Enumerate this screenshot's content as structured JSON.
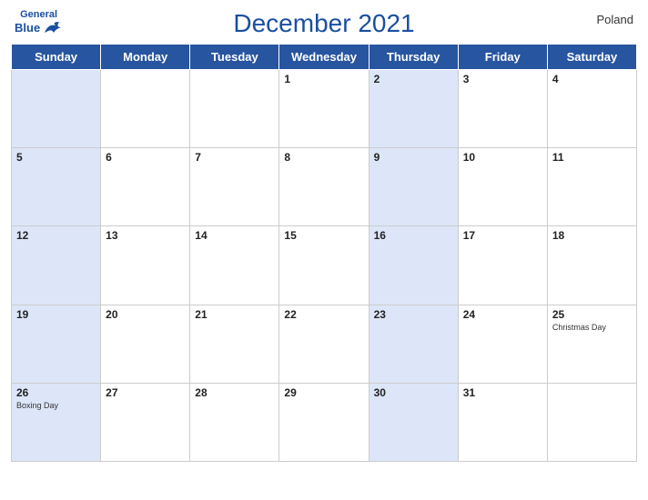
{
  "header": {
    "title": "December 2021",
    "country": "Poland",
    "logo": {
      "general": "General",
      "blue": "Blue"
    }
  },
  "days_of_week": [
    "Sunday",
    "Monday",
    "Tuesday",
    "Wednesday",
    "Thursday",
    "Friday",
    "Saturday"
  ],
  "weeks": [
    [
      {
        "num": "",
        "shaded": true,
        "holiday": ""
      },
      {
        "num": "",
        "shaded": false,
        "holiday": ""
      },
      {
        "num": "",
        "shaded": false,
        "holiday": ""
      },
      {
        "num": "1",
        "shaded": false,
        "holiday": ""
      },
      {
        "num": "2",
        "shaded": true,
        "holiday": ""
      },
      {
        "num": "3",
        "shaded": false,
        "holiday": ""
      },
      {
        "num": "4",
        "shaded": false,
        "holiday": ""
      }
    ],
    [
      {
        "num": "5",
        "shaded": true,
        "holiday": ""
      },
      {
        "num": "6",
        "shaded": false,
        "holiday": ""
      },
      {
        "num": "7",
        "shaded": false,
        "holiday": ""
      },
      {
        "num": "8",
        "shaded": false,
        "holiday": ""
      },
      {
        "num": "9",
        "shaded": true,
        "holiday": ""
      },
      {
        "num": "10",
        "shaded": false,
        "holiday": ""
      },
      {
        "num": "11",
        "shaded": false,
        "holiday": ""
      }
    ],
    [
      {
        "num": "12",
        "shaded": true,
        "holiday": ""
      },
      {
        "num": "13",
        "shaded": false,
        "holiday": ""
      },
      {
        "num": "14",
        "shaded": false,
        "holiday": ""
      },
      {
        "num": "15",
        "shaded": false,
        "holiday": ""
      },
      {
        "num": "16",
        "shaded": true,
        "holiday": ""
      },
      {
        "num": "17",
        "shaded": false,
        "holiday": ""
      },
      {
        "num": "18",
        "shaded": false,
        "holiday": ""
      }
    ],
    [
      {
        "num": "19",
        "shaded": true,
        "holiday": ""
      },
      {
        "num": "20",
        "shaded": false,
        "holiday": ""
      },
      {
        "num": "21",
        "shaded": false,
        "holiday": ""
      },
      {
        "num": "22",
        "shaded": false,
        "holiday": ""
      },
      {
        "num": "23",
        "shaded": true,
        "holiday": ""
      },
      {
        "num": "24",
        "shaded": false,
        "holiday": ""
      },
      {
        "num": "25",
        "shaded": false,
        "holiday": "Christmas Day"
      }
    ],
    [
      {
        "num": "26",
        "shaded": true,
        "holiday": "Boxing Day"
      },
      {
        "num": "27",
        "shaded": false,
        "holiday": ""
      },
      {
        "num": "28",
        "shaded": false,
        "holiday": ""
      },
      {
        "num": "29",
        "shaded": false,
        "holiday": ""
      },
      {
        "num": "30",
        "shaded": true,
        "holiday": ""
      },
      {
        "num": "31",
        "shaded": false,
        "holiday": ""
      },
      {
        "num": "",
        "shaded": false,
        "holiday": ""
      }
    ]
  ],
  "colors": {
    "header_bg": "#2855a0",
    "shaded_cell": "#dce6f8",
    "white_cell": "#ffffff",
    "text_blue": "#1a4fa0"
  }
}
